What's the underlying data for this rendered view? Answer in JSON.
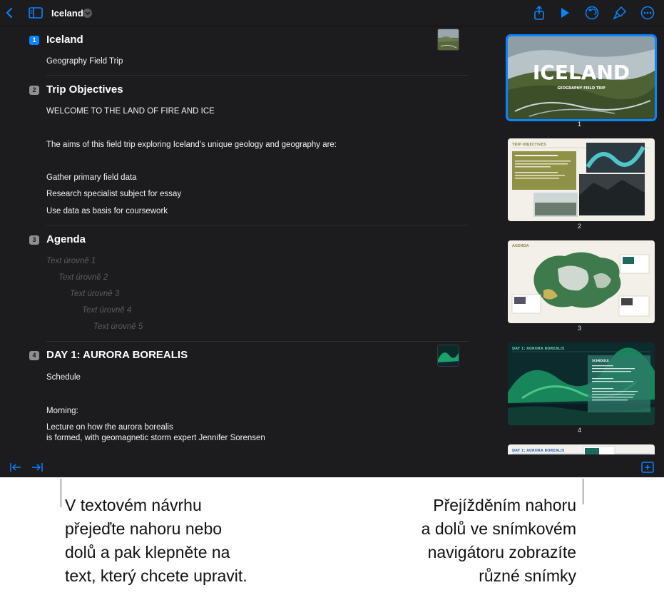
{
  "app": {
    "doc_title": "Iceland",
    "colors": {
      "accent": "#0a84ff",
      "background": "#1c1c1e"
    },
    "toolbar_icons": [
      "chevron-left-icon",
      "sidebar-icon",
      "share-icon",
      "play-icon",
      "undo-icon",
      "format-brush-icon",
      "more-icon"
    ]
  },
  "outline": {
    "slides": [
      {
        "number": "1",
        "title": "Iceland",
        "lines": [
          "Geography Field Trip"
        ]
      },
      {
        "number": "2",
        "title": "Trip Objectives",
        "lines": [
          "WELCOME TO THE LAND OF FIRE AND ICE",
          "The aims of this field trip exploring Iceland’s unique geology and geography are:",
          "Gather primary field data",
          "Research specialist subject for essay",
          "Use data as basis for coursework"
        ]
      },
      {
        "number": "3",
        "title": "Agenda",
        "placeholders": [
          "Text úrovně 1",
          "Text úrovně 2",
          "Text úrovně 3",
          "Text úrovně 4",
          "Text úrovně 5"
        ]
      },
      {
        "number": "4",
        "title": "DAY 1: AURORA BOREALIS",
        "lines": [
          "Schedule",
          "Morning:",
          "Lecture on how the aurora borealis",
          "is formed, with geomagnetic storm expert Jennifer Sorensen"
        ]
      }
    ]
  },
  "navigator": {
    "slides": [
      {
        "label": "1",
        "title": "ICELAND",
        "subtitle": "GEOGRAPHY FIELD TRIP"
      },
      {
        "label": "2",
        "header": "TRIP OBJECTIVES"
      },
      {
        "label": "3",
        "header": "AGENDA"
      },
      {
        "label": "4",
        "header": "DAY 1: AURORA BOREALIS",
        "box_title": "SCHEDULE"
      },
      {
        "label": "",
        "header": "DAY 1: AURORA BOREALIS"
      }
    ]
  },
  "bottombar": {
    "icons": [
      "outdent-icon",
      "indent-icon",
      "add-slide-icon"
    ]
  },
  "callouts": {
    "left": [
      "V textovém návrhu",
      "přejeďte nahoru nebo",
      "dolů a pak klepněte na",
      "text, který chcete upravit."
    ],
    "right": [
      "Přejížděním nahoru",
      "a dolů ve snímkovém",
      "navigátoru zobrazíte",
      "různé snímky"
    ]
  }
}
